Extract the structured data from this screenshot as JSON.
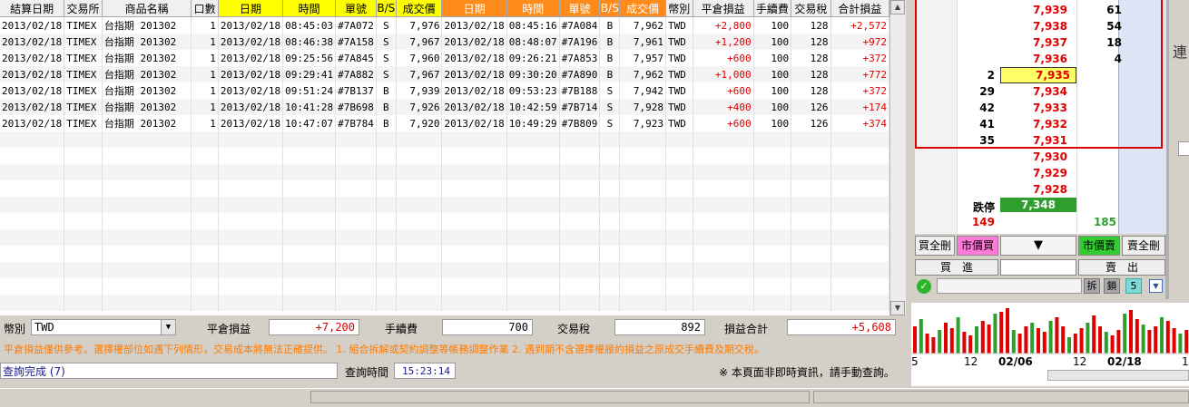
{
  "grid": {
    "headers": [
      {
        "label": "結算日期",
        "style": "n"
      },
      {
        "label": "交易所",
        "style": "n"
      },
      {
        "label": "商品名稱",
        "style": "n"
      },
      {
        "label": "口數",
        "style": "n"
      },
      {
        "label": "日期",
        "style": "y"
      },
      {
        "label": "時間",
        "style": "y"
      },
      {
        "label": "單號",
        "style": "y"
      },
      {
        "label": "B/S",
        "style": "y"
      },
      {
        "label": "成交價",
        "style": "y"
      },
      {
        "label": "日期",
        "style": "o"
      },
      {
        "label": "時間",
        "style": "o"
      },
      {
        "label": "單號",
        "style": "o"
      },
      {
        "label": "B/S",
        "style": "o"
      },
      {
        "label": "成交價",
        "style": "o"
      },
      {
        "label": "幣別",
        "style": "n"
      },
      {
        "label": "平倉損益",
        "style": "n"
      },
      {
        "label": "手續費",
        "style": "n"
      },
      {
        "label": "交易稅",
        "style": "n"
      },
      {
        "label": "合計損益",
        "style": "n"
      }
    ],
    "rows": [
      [
        "2013/02/18",
        "TIMEX",
        "台指期 201302",
        "1",
        "2013/02/18",
        "08:45:03",
        "#7A072",
        "S",
        "7,976",
        "2013/02/18",
        "08:45:16",
        "#7A084",
        "B",
        "7,962",
        "TWD",
        "+2,800",
        "100",
        "128",
        "+2,572"
      ],
      [
        "2013/02/18",
        "TIMEX",
        "台指期 201302",
        "1",
        "2013/02/18",
        "08:46:38",
        "#7A158",
        "S",
        "7,967",
        "2013/02/18",
        "08:48:07",
        "#7A196",
        "B",
        "7,961",
        "TWD",
        "+1,200",
        "100",
        "128",
        "+972"
      ],
      [
        "2013/02/18",
        "TIMEX",
        "台指期 201302",
        "1",
        "2013/02/18",
        "09:25:56",
        "#7A845",
        "S",
        "7,960",
        "2013/02/18",
        "09:26:21",
        "#7A853",
        "B",
        "7,957",
        "TWD",
        "+600",
        "100",
        "128",
        "+372"
      ],
      [
        "2013/02/18",
        "TIMEX",
        "台指期 201302",
        "1",
        "2013/02/18",
        "09:29:41",
        "#7A882",
        "S",
        "7,967",
        "2013/02/18",
        "09:30:20",
        "#7A890",
        "B",
        "7,962",
        "TWD",
        "+1,000",
        "100",
        "128",
        "+772"
      ],
      [
        "2013/02/18",
        "TIMEX",
        "台指期 201302",
        "1",
        "2013/02/18",
        "09:51:24",
        "#7B137",
        "B",
        "7,939",
        "2013/02/18",
        "09:53:23",
        "#7B188",
        "S",
        "7,942",
        "TWD",
        "+600",
        "100",
        "128",
        "+372"
      ],
      [
        "2013/02/18",
        "TIMEX",
        "台指期 201302",
        "1",
        "2013/02/18",
        "10:41:28",
        "#7B698",
        "B",
        "7,926",
        "2013/02/18",
        "10:42:59",
        "#7B714",
        "S",
        "7,928",
        "TWD",
        "+400",
        "100",
        "126",
        "+174"
      ],
      [
        "2013/02/18",
        "TIMEX",
        "台指期 201302",
        "1",
        "2013/02/18",
        "10:47:07",
        "#7B784",
        "B",
        "7,920",
        "2013/02/18",
        "10:49:29",
        "#7B809",
        "S",
        "7,923",
        "TWD",
        "+600",
        "100",
        "126",
        "+374"
      ]
    ]
  },
  "summary": {
    "currency_label": "幣別",
    "currency_value": "TWD",
    "pnl_label": "平倉損益",
    "pnl_value": "+7,200",
    "fee_label": "手續費",
    "fee_value": "700",
    "tax_label": "交易稅",
    "tax_value": "892",
    "total_label": "損益合計",
    "total_value": "+5,608"
  },
  "notice": "平倉損益僅供參考。選擇權部位如遇下列情形，交易成本將無法正確提供。 1. 組合拆解或契約調整等帳務調整作業  2. 遇到期不含選擇權履約損益之原成交手續費及期交稅。",
  "status": {
    "text": "查詢完成 (7)",
    "query_time_label": "查詢時間",
    "query_time": "15:23:14",
    "disclaimer": "※ 本頁面非即時資訊，請手動查詢。"
  },
  "orderbook": {
    "rows": [
      {
        "bid": "",
        "price": "7,939",
        "ask": "61"
      },
      {
        "bid": "",
        "price": "7,938",
        "ask": "54"
      },
      {
        "bid": "",
        "price": "7,937",
        "ask": "18"
      },
      {
        "bid": "",
        "price": "7,936",
        "ask": "4"
      },
      {
        "bid": "2",
        "price": "7,935",
        "ask": ""
      },
      {
        "bid": "29",
        "price": "7,934",
        "ask": ""
      },
      {
        "bid": "42",
        "price": "7,933",
        "ask": ""
      },
      {
        "bid": "41",
        "price": "7,932",
        "ask": ""
      },
      {
        "bid": "35",
        "price": "7,931",
        "ask": ""
      },
      {
        "bid": "",
        "price": "7,930",
        "ask": ""
      },
      {
        "bid": "",
        "price": "7,929",
        "ask": ""
      },
      {
        "bid": "",
        "price": "7,928",
        "ask": ""
      }
    ],
    "limit_down_label": "跌停",
    "limit_down_price": "7,348",
    "bid_total": "149",
    "ask_total": "185",
    "buy_all_delete": "買全刪",
    "market_buy": "市價買",
    "market_sell": "市價賣",
    "sell_all_delete": "賣全刪",
    "buy_in": "買　進",
    "sell_out": "賣　出",
    "btn_split": "拆",
    "btn_lock": "鎖",
    "btn_five": "5"
  },
  "mini_chart": {
    "x_labels": [
      "5",
      "12",
      "02/06",
      "12",
      "02/18",
      "1"
    ]
  },
  "edge_label": "連"
}
